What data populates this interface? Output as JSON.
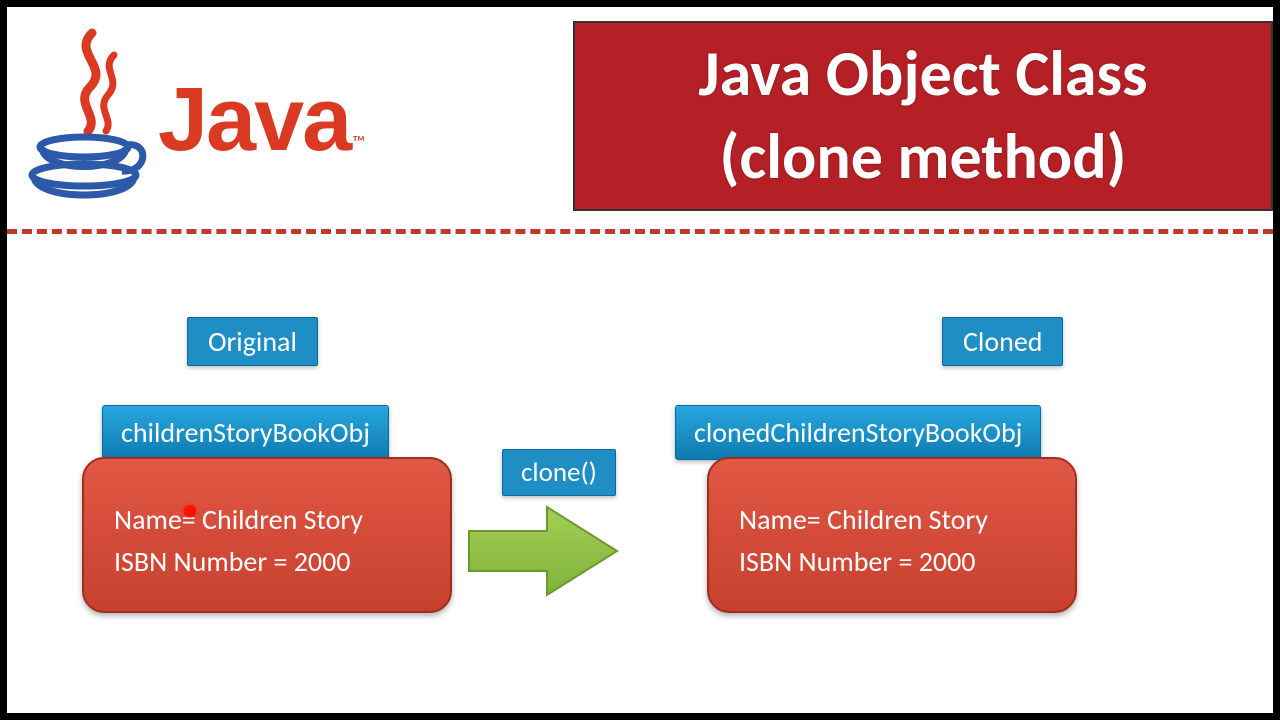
{
  "header": {
    "logo_text": "Java",
    "trademark": "™",
    "title_line1": "Java Object Class",
    "title_line2": "(clone method)"
  },
  "diagram": {
    "original": {
      "badge": "Original",
      "var_name": "childrenStoryBookObj",
      "field1": "Name= Children Story",
      "field2": "ISBN Number = 2000"
    },
    "method_label": "clone()",
    "cloned": {
      "badge": "Cloned",
      "var_name": "clonedChildrenStoryBookObj",
      "field1": "Name= Children Story",
      "field2": "ISBN Number = 2000"
    }
  }
}
